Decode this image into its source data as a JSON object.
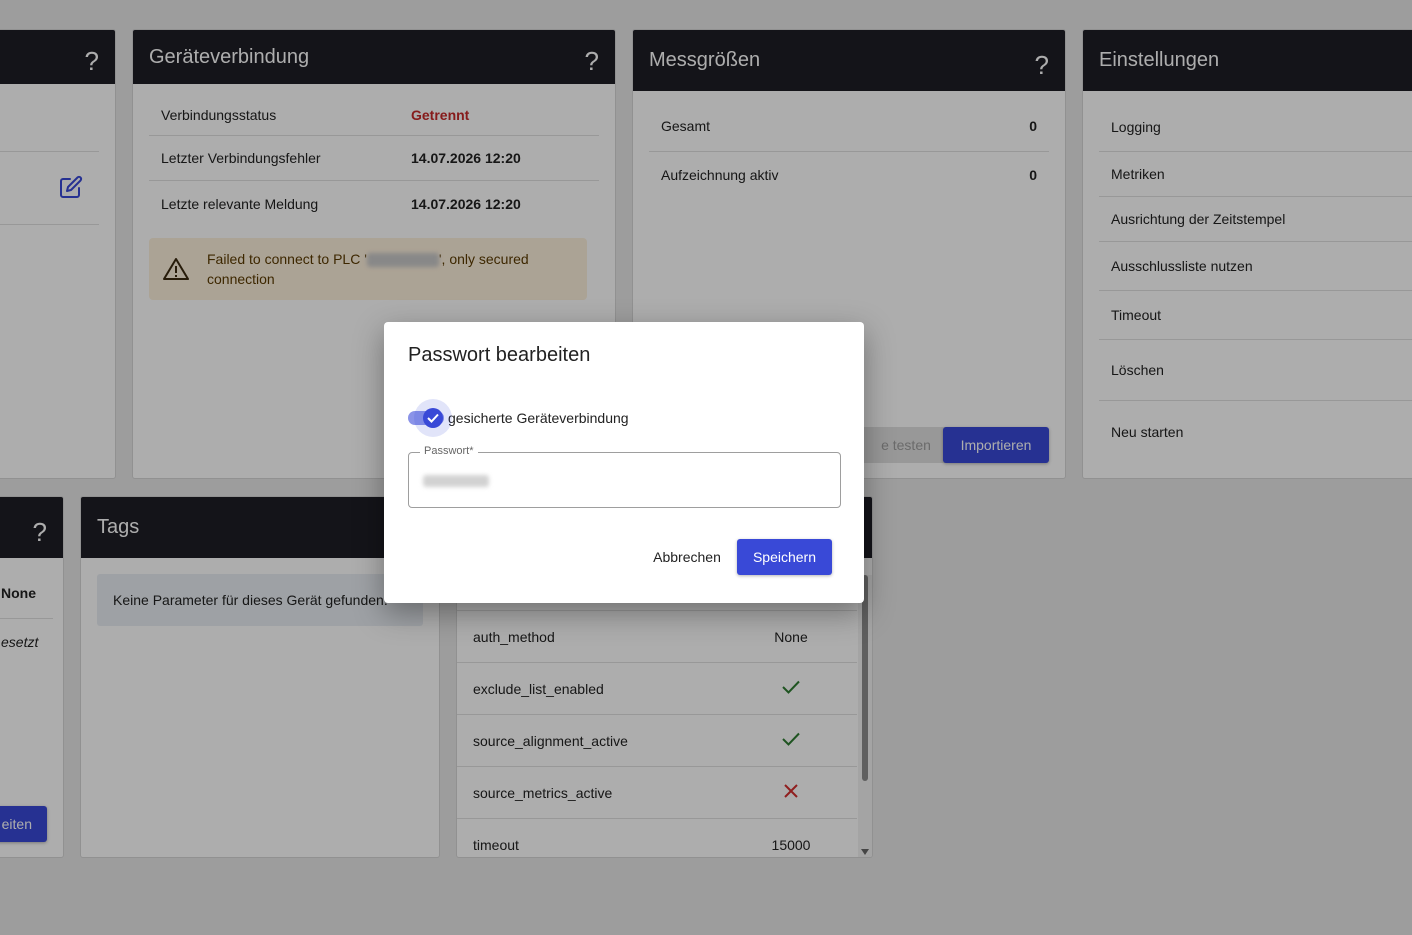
{
  "left_card": {
    "help": "?"
  },
  "device_connection": {
    "title": "Geräteverbindung",
    "help": "?",
    "rows": [
      {
        "label": "Verbindungsstatus",
        "value": "Getrennt"
      },
      {
        "label": "Letzter Verbindungsfehler",
        "value": "14.07.2026 12:20"
      },
      {
        "label": "Letzte relevante Meldung",
        "value": "14.07.2026 12:20"
      }
    ],
    "warning_prefix": "Failed to connect to PLC '",
    "warning_suffix": "', only secured connection",
    "colors": {
      "error": "#c62828",
      "warning_bg": "#fdf0dc"
    }
  },
  "measures": {
    "title": "Messgrößen",
    "help": "?",
    "rows": [
      {
        "label": "Gesamt",
        "value": "0"
      },
      {
        "label": "Aufzeichnung aktiv",
        "value": "0"
      }
    ],
    "test_button": "e testen",
    "import_button": "Importieren"
  },
  "settings": {
    "title": "Einstellungen",
    "items": [
      "Logging",
      "Metriken",
      "Ausrichtung der Zeitstempel",
      "Ausschlussliste nutzen",
      "Timeout",
      "Löschen",
      "Neu starten"
    ]
  },
  "bottom_left": {
    "help": "?",
    "row1": "None",
    "row2": "esetzt",
    "button": "eiten"
  },
  "tags": {
    "title": "Tags",
    "empty_message": "Keine Parameter für dieses Gerät gefunden."
  },
  "params": {
    "rows": [
      {
        "key": "auth_method",
        "value": "None",
        "icon": ""
      },
      {
        "key": "exclude_list_enabled",
        "value": "",
        "icon": "check-icon"
      },
      {
        "key": "source_alignment_active",
        "value": "",
        "icon": "check-icon"
      },
      {
        "key": "source_metrics_active",
        "value": "",
        "icon": "cross-icon"
      },
      {
        "key": "timeout",
        "value": "15000",
        "icon": ""
      }
    ]
  },
  "dialog": {
    "title": "Passwort bearbeiten",
    "toggle_label": "gesicherte Geräteverbindung",
    "toggle_on": true,
    "password_label": "Passwort*",
    "cancel": "Abbrechen",
    "save": "Speichern"
  },
  "accent": "#3949d7"
}
